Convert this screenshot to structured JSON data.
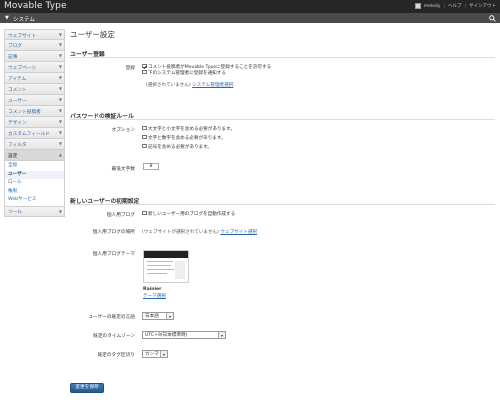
{
  "header": {
    "app_title": "Movable Type",
    "user": "melody",
    "help": "ヘルプ",
    "logout": "サインアウト",
    "scope": "システム"
  },
  "sidebar": {
    "items": [
      {
        "label": "ウェブサイト"
      },
      {
        "label": "ブログ"
      },
      {
        "label": "記事"
      },
      {
        "label": "ウェブページ"
      },
      {
        "label": "アイテム"
      },
      {
        "label": "コメント"
      },
      {
        "label": "ユーザー"
      },
      {
        "label": "コメント投稿者"
      },
      {
        "label": "デザイン"
      },
      {
        "label": "カスタムフィールド"
      },
      {
        "label": "フィルタ"
      }
    ],
    "settings": {
      "label": "設定",
      "sub_items": [
        {
          "label": "全般"
        },
        {
          "label": "ユーザー"
        },
        {
          "label": "ロール"
        },
        {
          "label": "権限"
        },
        {
          "label": "Webサービス"
        }
      ]
    },
    "tools": {
      "label": "ツール"
    }
  },
  "main": {
    "page_title": "ユーザー設定",
    "registration": {
      "title": "ユーザー登録",
      "label": "登録",
      "option1": "コメント投稿者がMovable Typeに登録することを許可する",
      "option2": "下のシステム管理者に登録を通知する",
      "not_selected": "(選択されていません)",
      "select_admin_link": "システム管理者選択"
    },
    "password": {
      "title": "パスワードの検証ルール",
      "options_label": "オプション",
      "options": [
        "大文字と小文字を含める必要があります。",
        "文字と数字を含める必要があります。",
        "記号を含める必要があります。"
      ],
      "min_length_label": "最低文字数",
      "min_length_value": "8"
    },
    "new_user": {
      "title": "新しいユーザーの初期設定",
      "personal_blog_label": "個人用ブログ",
      "personal_blog_option": "新しいユーザー用のブログを自動作成する",
      "location_label": "個人用ブログの場所",
      "location_value": "(ウェブサイトが選択されていません)",
      "location_link": "ウェブサイト選択",
      "theme_label": "個人用ブログテーマ",
      "theme_name": "Rainier",
      "theme_select": "テーマ選択",
      "language_label": "ユーザーの既定の言語",
      "language_value": "日本語",
      "timezone_label": "既定のタイムゾーン",
      "timezone_value": "UTC+9(日本標準時)",
      "tag_delim_label": "既定のタグ区切り",
      "tag_delim_value": "カンマ"
    },
    "save_button": "変更を保存"
  }
}
